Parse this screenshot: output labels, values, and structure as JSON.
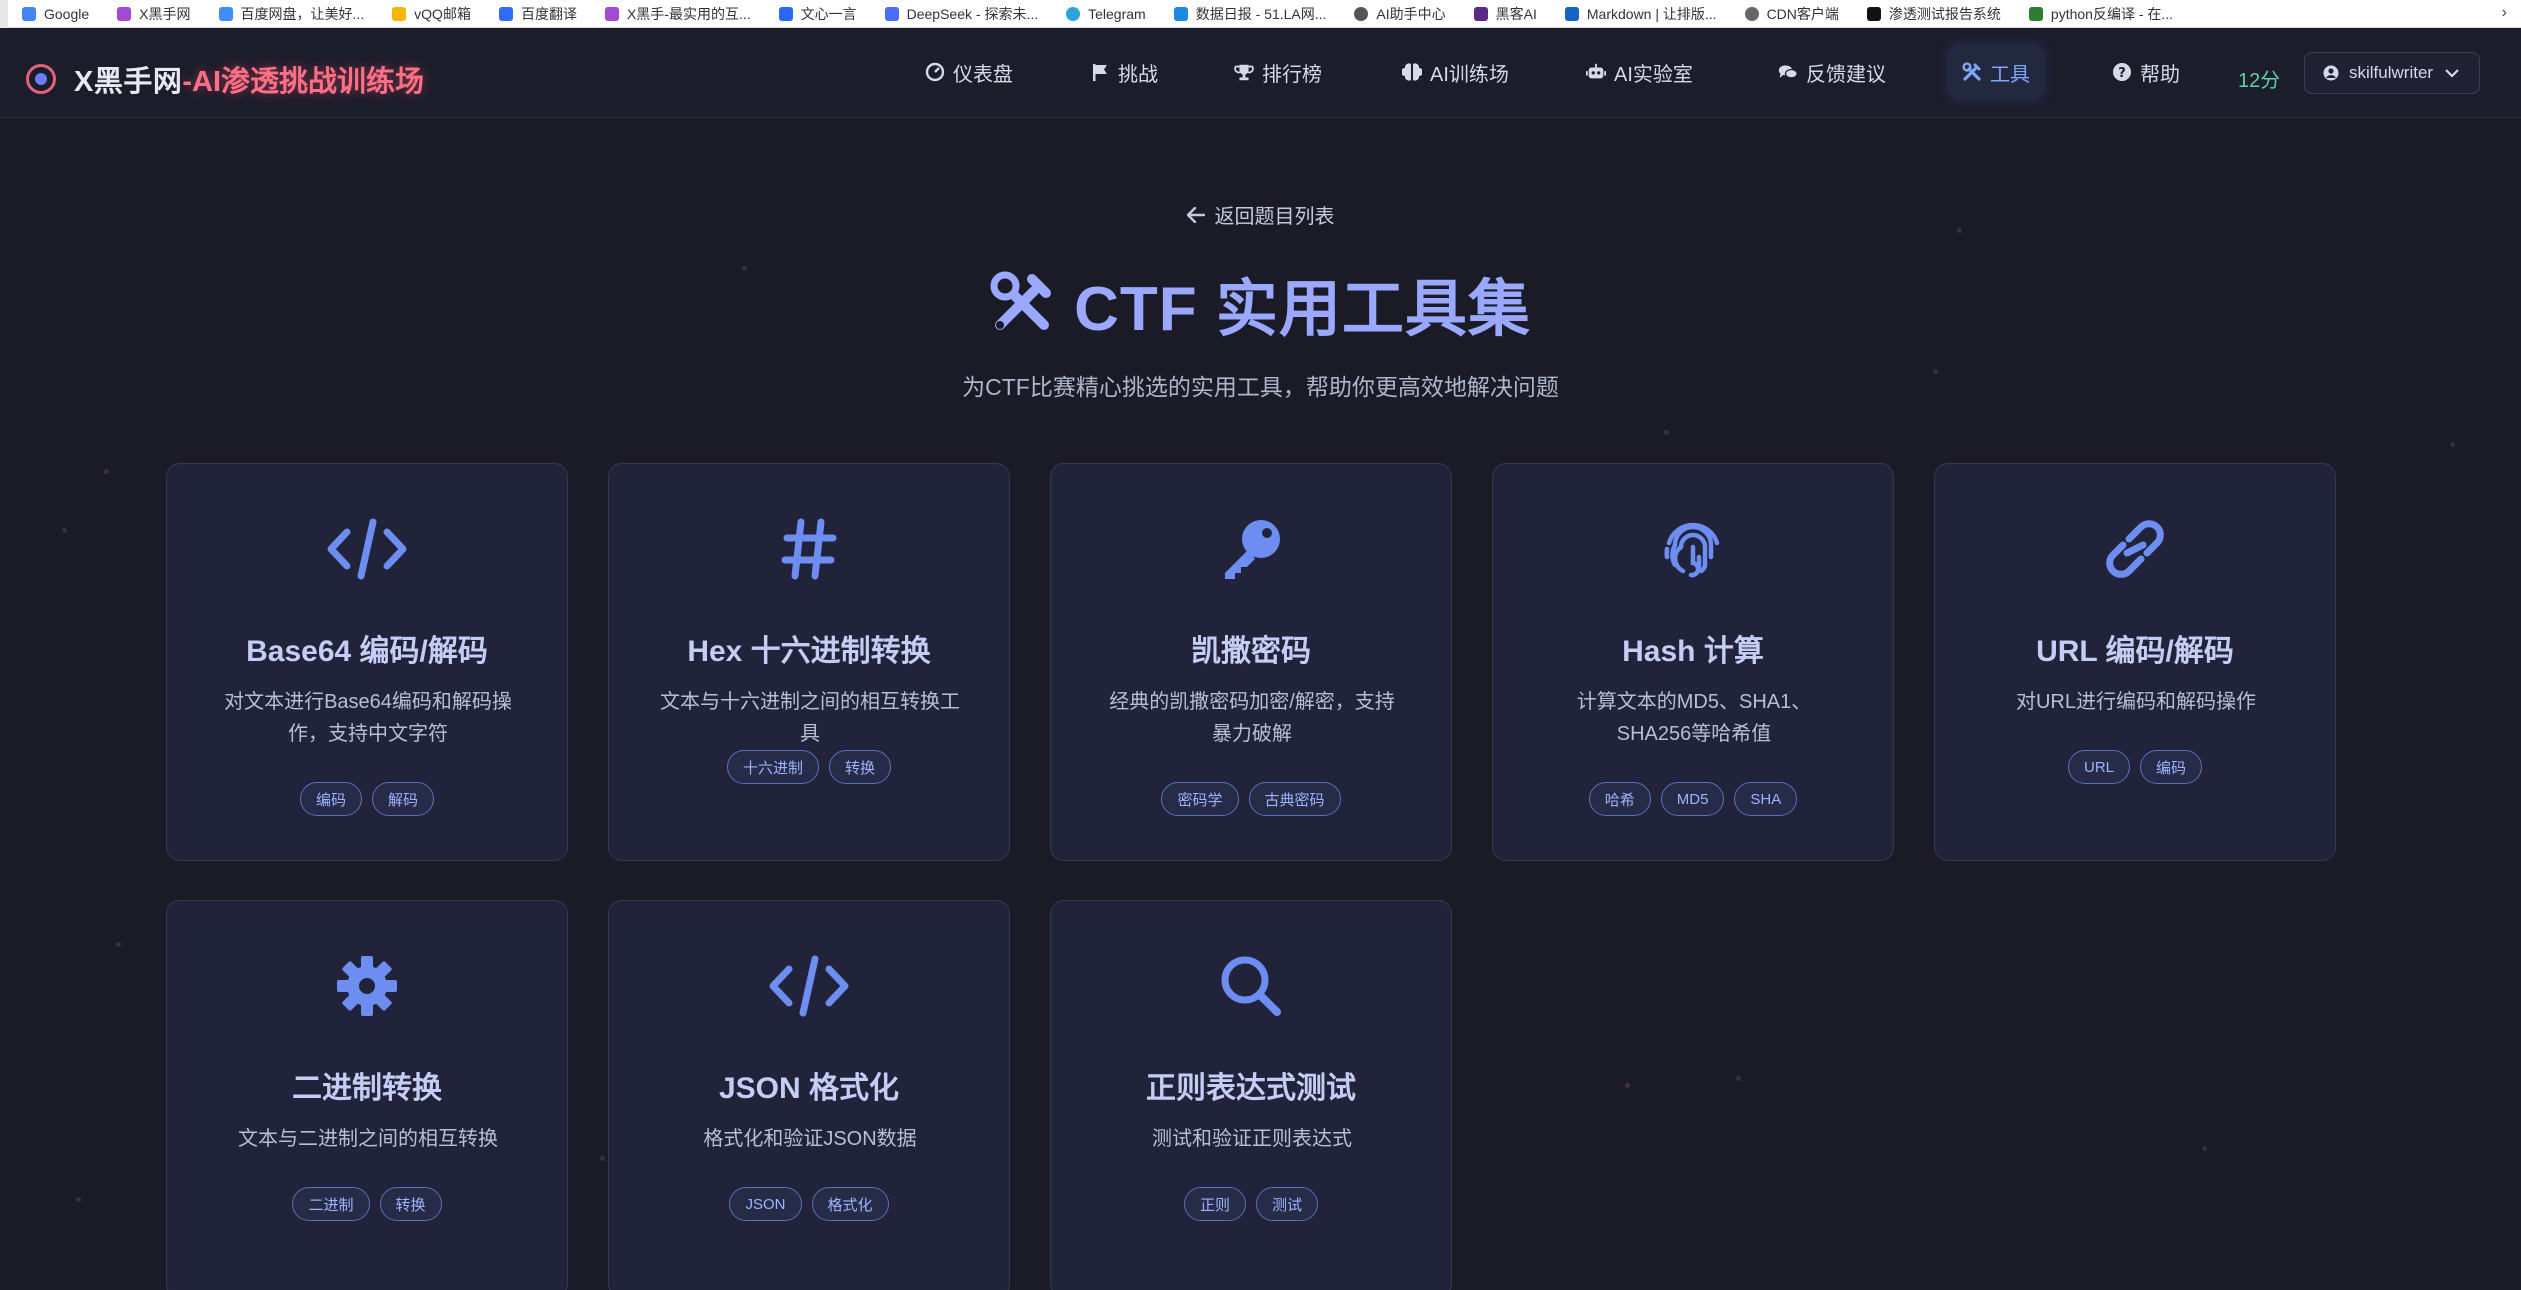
{
  "bookmarks": [
    {
      "label": "Google",
      "color": "#4285f4"
    },
    {
      "label": "X黑手网",
      "color": "#a04ad6"
    },
    {
      "label": "百度网盘，让美好...",
      "color": "#3f8cff"
    },
    {
      "label": "vQQ邮箱",
      "color": "#f5b800"
    },
    {
      "label": "百度翻译",
      "color": "#2f6bff"
    },
    {
      "label": "X黑手-最实用的互...",
      "color": "#a04ad6"
    },
    {
      "label": "文心一言",
      "color": "#2b67f6"
    },
    {
      "label": "DeepSeek - 探索未...",
      "color": "#4d6bfe"
    },
    {
      "label": "Telegram",
      "color": "#2aa3df"
    },
    {
      "label": "数据日报 - 51.LA网...",
      "color": "#1e88e5"
    },
    {
      "label": "AI助手中心",
      "color": "#555555"
    },
    {
      "label": "黑客AI",
      "color": "#5b2a86"
    },
    {
      "label": "Markdown | 让排版...",
      "color": "#1565c0"
    },
    {
      "label": "CDN客户端",
      "color": "#666666"
    },
    {
      "label": "渗透测试报告系统",
      "color": "#111111"
    },
    {
      "label": "python反编译 - 在...",
      "color": "#2e7d32"
    }
  ],
  "nav": {
    "logo_main": "X黑手网",
    "logo_accent": "-AI渗透挑战训练场",
    "items": [
      {
        "label": "仪表盘",
        "icon": "dashboard-icon"
      },
      {
        "label": "挑战",
        "icon": "flag-icon"
      },
      {
        "label": "排行榜",
        "icon": "trophy-icon"
      },
      {
        "label": "AI训练场",
        "icon": "brain-icon"
      },
      {
        "label": "AI实验室",
        "icon": "robot-icon"
      },
      {
        "label": "反馈建议",
        "icon": "comments-icon"
      },
      {
        "label": "工具",
        "icon": "tools-icon"
      },
      {
        "label": "帮助",
        "icon": "question-icon"
      }
    ],
    "active_item": "工具",
    "score": "12分",
    "username": "skilfulwriter"
  },
  "header": {
    "back_label": "返回题目列表",
    "title": "CTF 实用工具集",
    "subtitle": "为CTF比赛精心挑选的实用工具，帮助你更高效地解决问题"
  },
  "tools": [
    {
      "title": "Base64 编码/解码",
      "desc": "对文本进行Base64编码和解码操作，支持中文字符",
      "tags": [
        "编码",
        "解码"
      ],
      "icon": "code-icon"
    },
    {
      "title": "Hex 十六进制转换",
      "desc": "文本与十六进制之间的相互转换工具",
      "tags": [
        "十六进制",
        "转换"
      ],
      "icon": "hashtag-icon"
    },
    {
      "title": "凯撒密码",
      "desc": "经典的凯撒密码加密/解密，支持暴力破解",
      "tags": [
        "密码学",
        "古典密码"
      ],
      "icon": "key-icon"
    },
    {
      "title": "Hash 计算",
      "desc": "计算文本的MD5、SHA1、SHA256等哈希值",
      "tags": [
        "哈希",
        "MD5",
        "SHA"
      ],
      "icon": "fingerprint-icon"
    },
    {
      "title": "URL 编码/解码",
      "desc": "对URL进行编码和解码操作",
      "tags": [
        "URL",
        "编码"
      ],
      "icon": "link-icon"
    },
    {
      "title": "二进制转换",
      "desc": "文本与二进制之间的相互转换",
      "tags": [
        "二进制",
        "转换"
      ],
      "icon": "gear-icon"
    },
    {
      "title": "JSON 格式化",
      "desc": "格式化和验证JSON数据",
      "tags": [
        "JSON",
        "格式化"
      ],
      "icon": "code-icon"
    },
    {
      "title": "正则表达式测试",
      "desc": "测试和验证正则表达式",
      "tags": [
        "正则",
        "测试"
      ],
      "icon": "search-icon"
    }
  ],
  "colors": {
    "accent": "#7fa6ff",
    "icon_blue": "#6d8ef0",
    "logo_accent": "#ff6f86",
    "score": "#5fd3a3"
  }
}
